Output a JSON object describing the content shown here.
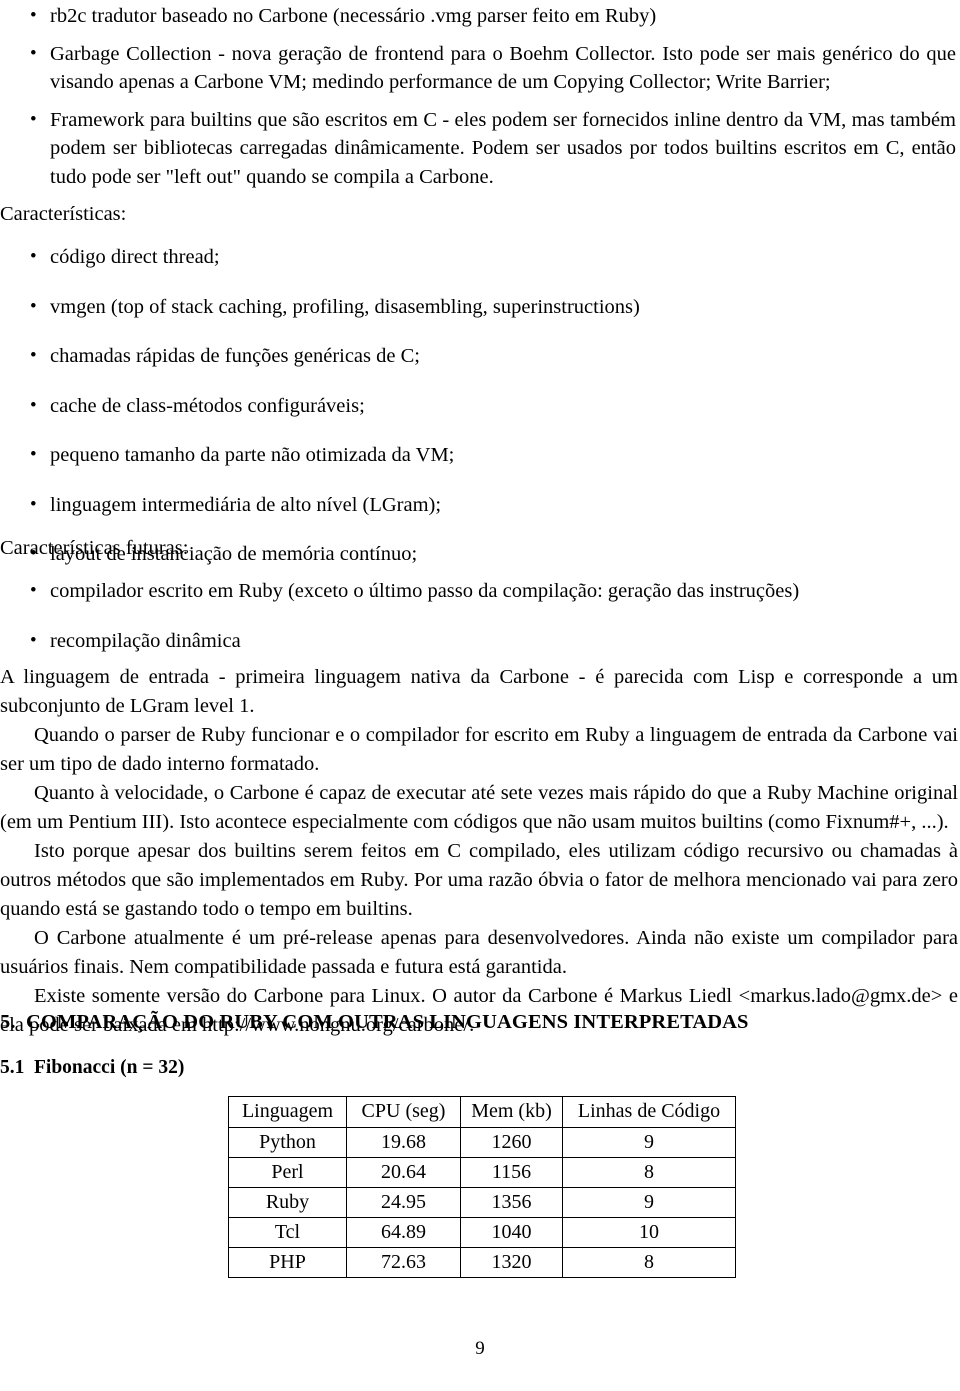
{
  "top_bullets": [
    "rb2c tradutor baseado no Carbone (necessário .vmg parser feito em Ruby)",
    "Garbage Collection - nova geração de frontend para o Boehm Collector.  Isto pode ser mais genérico do que visando apenas a Carbone VM; medindo performance de um Copying Collector; Write Barrier;",
    "Framework para builtins que são escritos em C - eles podem ser fornecidos inline dentro da VM, mas também podem ser bibliotecas carregadas dinâmicamente. Podem ser usados por todos builtins escritos em C, então tudo pode ser \"left out\" quando se compila a Carbone."
  ],
  "caracteristicas_label": "Características:",
  "caracteristicas": [
    "código direct thread;",
    "vmgen (top of stack caching, profiling, disasembling, superinstructions)",
    "chamadas rápidas de funções genéricas de C;",
    "cache de class-métodos configuráveis;",
    "pequeno tamanho da parte não otimizada da VM;",
    "linguagem intermediária de alto nível (LGram);",
    "layout de instanciação de memória contínuo;"
  ],
  "caracteristicas_futuras_label": "Características futuras:",
  "caracteristicas_futuras": [
    "compilador escrito em Ruby (exceto o último passo da compilação: geração das instruções)",
    "recompilação dinâmica"
  ],
  "paragraphs": [
    "A linguagem de entrada - primeira linguagem nativa da Carbone - é parecida com Lisp e corresponde a um subconjunto de LGram level 1.",
    "Quando o parser de Ruby funcionar e o compilador for escrito em Ruby a linguagem de entrada da Carbone vai ser um tipo de dado interno formatado.",
    "Quanto à velocidade, o Carbone é capaz de executar até sete vezes mais rápido do que a Ruby Machine original (em um Pentium III). Isto acontece especialmente com códigos que não usam muitos builtins (como Fixnum#+, ...).",
    "Isto porque apesar dos builtins serem feitos em C compilado, eles utilizam código recursivo ou chamadas à outros métodos que são implementados em Ruby. Por uma razão óbvia o fator de melhora mencionado vai para zero quando está se gastando todo o tempo em builtins.",
    "O Carbone atualmente é um pré-release apenas para desenvolvedores.  Ainda não existe um compilador para usuários finais. Nem compatibilidade passada e futura está garantida.",
    "Existe somente versão do Carbone para Linux. O autor da Carbone é Markus Liedl <markus.lado@gmx.de> e ela pode ser baixada em http://www.nongnu.org/carbone/."
  ],
  "section": {
    "number": "5.",
    "title": "COMPARAÇÃO DO RUBY COM OUTRAS LINGUAGENS INTERPRETADAS"
  },
  "subsection": {
    "number": "5.1",
    "title": "Fibonacci (n = 32)"
  },
  "chart_data": {
    "type": "table",
    "title": "Fibonacci (n = 32)",
    "columns": [
      "Linguagem",
      "CPU (seg)",
      "Mem (kb)",
      "Linhas de Código"
    ],
    "rows": [
      [
        "Python",
        "19.68",
        "1260",
        "9"
      ],
      [
        "Perl",
        "20.64",
        "1156",
        "8"
      ],
      [
        "Ruby",
        "24.95",
        "1356",
        "9"
      ],
      [
        "Tcl",
        "64.89",
        "1040",
        "10"
      ],
      [
        "PHP",
        "72.63",
        "1320",
        "8"
      ]
    ]
  },
  "page_number": "9"
}
